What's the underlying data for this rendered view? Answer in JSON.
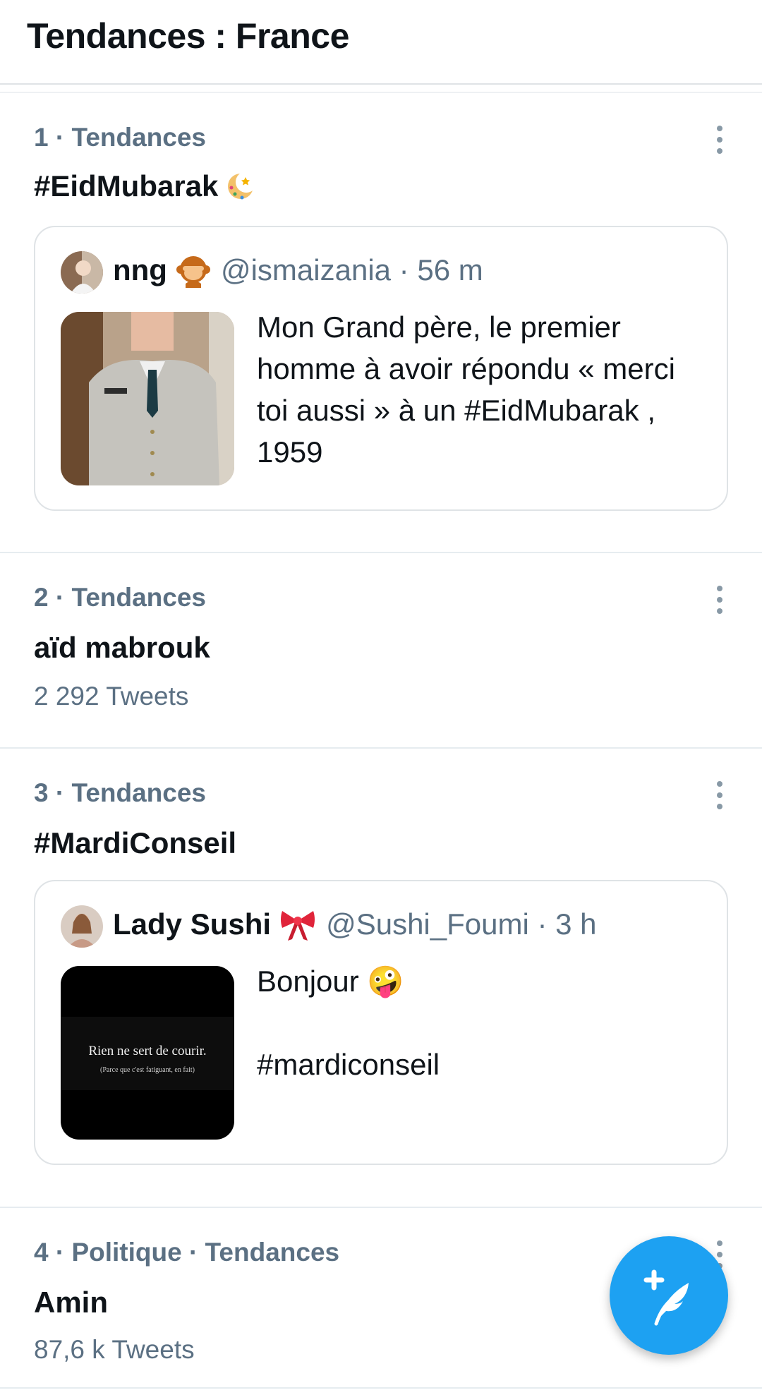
{
  "header": {
    "title": "Tendances : France"
  },
  "trends": [
    {
      "meta": "1 · Tendances",
      "name": "#EidMubarak",
      "tweet": {
        "author_name": "nng",
        "handle_time": "@ismaizania · 56 m",
        "text": "Mon Grand père, le premier homme à avoir répondu « merci toi aussi » à un #EidMubarak , 1959"
      }
    },
    {
      "meta": "2 · Tendances",
      "name": "aïd mabrouk",
      "count": "2 292 Tweets"
    },
    {
      "meta": "3 · Tendances",
      "name": "#MardiConseil",
      "tweet": {
        "author_name": "Lady Sushi",
        "handle_time": "@Sushi_Foumi · 3 h",
        "text": "Bonjour 🤪\n\n#mardiconseil",
        "image_text_main": "Rien ne sert de courir.",
        "image_text_sub": "(Parce que c'est fatiguant, en fait)"
      }
    },
    {
      "meta": "4 · Politique · Tendances",
      "name": "Amin",
      "count": "87,6 k Tweets"
    }
  ],
  "icons": {
    "more": "more-vertical-icon",
    "compose": "compose-tweet-icon",
    "crescent": "crescent-moon-icon",
    "monkey": "monkey-emoji-icon",
    "ribbon": "ribbon-emoji-icon"
  },
  "colors": {
    "accent": "#1da1f2",
    "secondary_text": "#5b7083",
    "border": "#dfe3e6"
  }
}
